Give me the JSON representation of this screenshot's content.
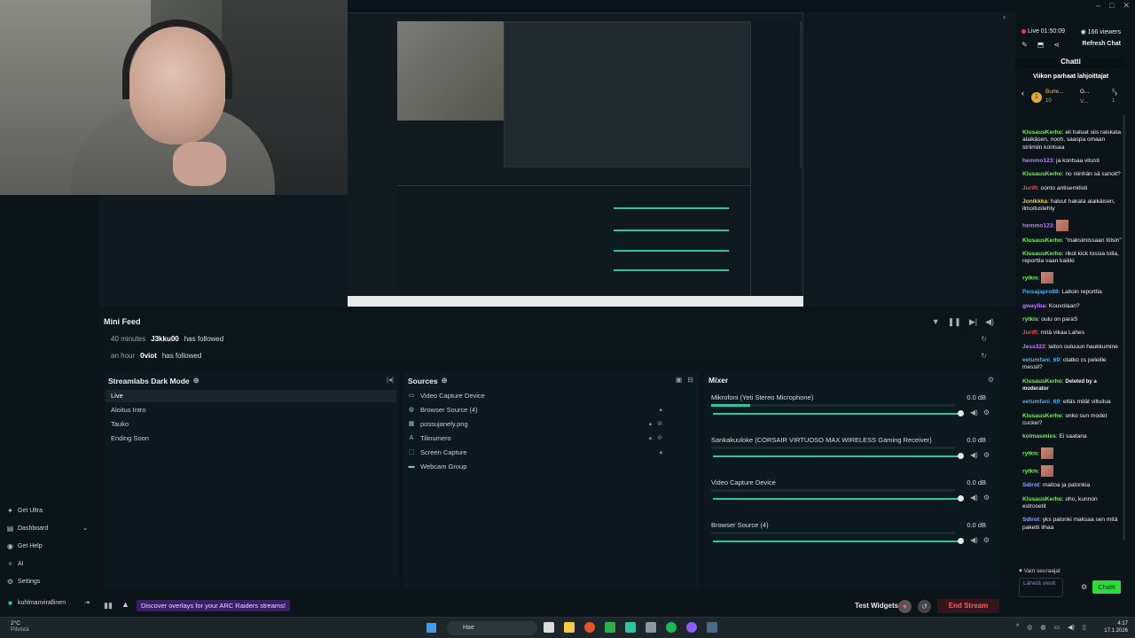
{
  "window": {
    "minimize": "–",
    "maximize": "□",
    "close": "✕"
  },
  "mini_feed": {
    "title": "Mini Feed",
    "rows": [
      {
        "time": "40 minutes",
        "user": "J3kku00",
        "action": "has followed"
      },
      {
        "time": "an hour",
        "user": "0viot",
        "action": "has followed"
      }
    ]
  },
  "scenes": {
    "title": "Streamlabs Dark Mode",
    "items": [
      "Live",
      "Aloitus Intro",
      "Tauko",
      "Ending Soon"
    ]
  },
  "sources": {
    "title": "Sources",
    "items": [
      {
        "label": "Video Capture Device",
        "icon": "camera-icon"
      },
      {
        "label": "Browser Source (4)",
        "icon": "globe-icon"
      },
      {
        "label": "possujanely.png",
        "icon": "image-icon"
      },
      {
        "label": "Tilinumero",
        "icon": "text-icon"
      },
      {
        "label": "Screen Capture",
        "icon": "screen-icon"
      },
      {
        "label": "Webcam Group",
        "icon": "folder-icon"
      }
    ]
  },
  "mixer": {
    "title": "Mixer",
    "items": [
      {
        "name": "Mikrofoni (Yeti Stereo Microphone)",
        "db": "0.0 dB",
        "level": 0.16
      },
      {
        "name": "Sankakuuloke (CORSAIR VIRTUOSO MAX WIRELESS Gaming Receiver)",
        "db": "0.0 dB",
        "level": 0.0
      },
      {
        "name": "Video Capture Device",
        "db": "0.0 dB",
        "level": 0.0
      },
      {
        "name": "Browser Source (4)",
        "db": "0.0 dB",
        "level": 0.0
      }
    ]
  },
  "left_nav": [
    {
      "label": "Get Ultra",
      "icon": "ultra-icon"
    },
    {
      "label": "Dashboard",
      "icon": "dashboard-icon"
    },
    {
      "label": "Get Help",
      "icon": "help-icon"
    },
    {
      "label": "AI",
      "icon": "ai-icon"
    },
    {
      "label": "Settings",
      "icon": "gear-icon"
    },
    {
      "label": "kuhlmanvirallinen",
      "icon": "profile-icon"
    }
  ],
  "bottom_bar": {
    "promo": "Discover overlays for your ARC Raiders streams!",
    "test_widgets": "Test Widgets",
    "end_stream": "End Stream"
  },
  "chat": {
    "live_time": "Live 01:50:09",
    "viewers": "166 viewers",
    "refresh": "Refresh Chat",
    "heading": "Chatti",
    "weekly_title": "Viikon parhaat lahjoittajat",
    "top_gifter": "Burle...",
    "top_gifter_count": "10",
    "gifter2": "G...",
    "gifter2_count": "6",
    "gifter3": "V...",
    "gifter3_count": "1",
    "messages": [
      {
        "user": "KlusausKerho",
        "color": "#7ce86a",
        "text": "eli haluat siis raiskata alaikäsen, nooh, saaspa omaan striimiin kontsaa"
      },
      {
        "user": "hemmo123",
        "color": "#c479ff",
        "text": "ja kontsaa vitusti"
      },
      {
        "user": "KlusausKerho",
        "color": "#7ce86a",
        "text": "no niinhän sä sanoit?"
      },
      {
        "user": "JuriR",
        "color": "#ff4a4a",
        "text": "oonto antisemitisti"
      },
      {
        "user": "Jonikkka",
        "color": "#f4d03f",
        "text": "haluut hakata alaikäisen, ilmoitustehty"
      },
      {
        "user": "hemmo123",
        "color": "#c479ff",
        "text": ""
      },
      {
        "user": "KlusausKerho",
        "color": "#7ce86a",
        "text": "\"maksimissaan lölsin\""
      },
      {
        "user": "KlusausKerho",
        "color": "#7ce86a",
        "text": "rikot kick tossia tolla, reporttia vaan kaikki"
      },
      {
        "user": "rytkis",
        "color": "#7ce86a",
        "text": ""
      },
      {
        "user": "Peisajapro88",
        "color": "#3ab4ff",
        "text": "Laitoin reporttia"
      },
      {
        "user": "gwaylba",
        "color": "#c479ff",
        "text": "Kouvolaan?"
      },
      {
        "user": "rytkis",
        "color": "#7ce86a",
        "text": "oulu on paraS"
      },
      {
        "user": "JuriR",
        "color": "#ff4a4a",
        "text": "mitä vikaa Lahes"
      },
      {
        "user": "Jess322",
        "color": "#c479ff",
        "text": "laiton ouluuun haukkumine"
      },
      {
        "user": "eetumfani_69",
        "color": "#3ab4ff",
        "text": "otatko cs peleille messiI?"
      },
      {
        "user": "KlusausKerho",
        "color": "#7ce86a",
        "text": "Deleted by a moderator"
      },
      {
        "user": "eetumfani_69",
        "color": "#3ab4ff",
        "text": "eltäs mität viltuilua"
      },
      {
        "user": "KlusausKerho",
        "color": "#7ce86a",
        "text": "onko sun modet cuckei?"
      },
      {
        "user": "kolmasmies",
        "color": "#7ce86a",
        "text": "Ei saatana"
      },
      {
        "user": "rytkis",
        "color": "#7ce86a",
        "text": ""
      },
      {
        "user": "rytkis",
        "color": "#7ce86a",
        "text": ""
      },
      {
        "user": "Sdirot",
        "color": "#8fa7ff",
        "text": "maitoa ja patonkia"
      },
      {
        "user": "KlusausKerho",
        "color": "#7ce86a",
        "text": "oho, kunnon estrosetit"
      },
      {
        "user": "Sdirot",
        "color": "#8fa7ff",
        "text": "yks patonki maksaa sen mitä paketti lihaa"
      }
    ],
    "followers_only": "Vain seuraajat",
    "input_placeholder": "Lähetä viesti",
    "send": "Chatti"
  },
  "taskbar": {
    "temp": "2°C",
    "weather": "Pilvistä",
    "search_placeholder": "Hae",
    "time": "4:17",
    "date": "17.1.2026"
  },
  "colors": {
    "accent": "#31c3a2",
    "end_stream": "#ff5e5e",
    "send": "#2ddc3a"
  }
}
